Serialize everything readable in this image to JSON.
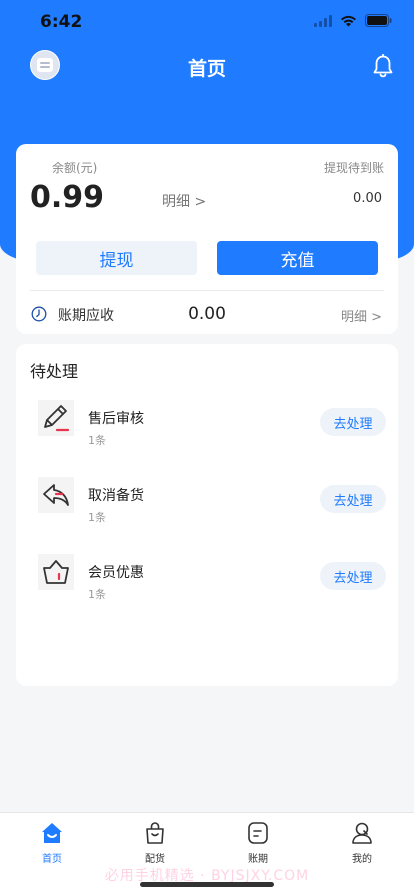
{
  "status_bar": {
    "time": "6:42"
  },
  "header": {
    "title": "首页"
  },
  "balance": {
    "label": "余额(元)",
    "value": "0.99",
    "detail_link": "明细 >",
    "pending_label": "提现待到账",
    "pending_value": "0.00",
    "withdraw_label": "提现",
    "recharge_label": "充值",
    "period_label": "账期应收",
    "period_value": "0.00",
    "period_detail": "明细 >"
  },
  "pending": {
    "title": "待处理",
    "items": [
      {
        "title": "售后审核",
        "count": "1条",
        "action": "去处理",
        "icon": "pen-edit-icon"
      },
      {
        "title": "取消备货",
        "count": "1条",
        "action": "去处理",
        "icon": "undo-arrow-icon"
      },
      {
        "title": "会员优惠",
        "count": "1条",
        "action": "去处理",
        "icon": "basket-icon"
      }
    ]
  },
  "tabs": [
    {
      "label": "首页",
      "icon": "home-icon",
      "active": true
    },
    {
      "label": "配货",
      "icon": "shopping-bag-icon",
      "active": false
    },
    {
      "label": "账期",
      "icon": "bill-icon",
      "active": false
    },
    {
      "label": "我的",
      "icon": "user-icon",
      "active": false
    }
  ],
  "watermark": "必用手机精选 · BYJSJXY.COM",
  "colors": {
    "primary": "#1f7bff",
    "accent_red": "#e8344e",
    "background": "#f5f6f8"
  }
}
